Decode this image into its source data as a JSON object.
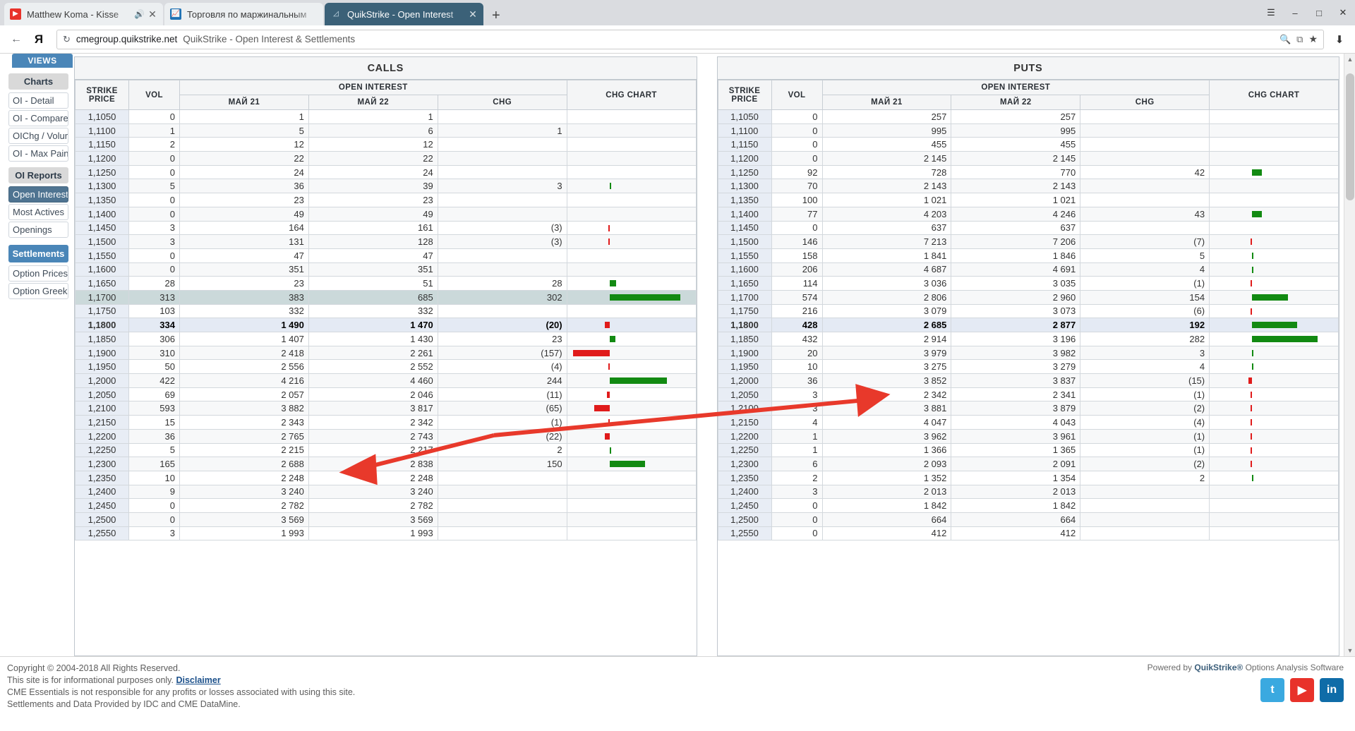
{
  "browser": {
    "tabs": [
      {
        "title": "Matthew Koma - Kisse",
        "icon": "youtube-icon",
        "muted": true,
        "active": false
      },
      {
        "title": "Торговля по маржинальным",
        "icon": "chart-icon",
        "muted": false,
        "active": false
      },
      {
        "title": "QuikStrike - Open Interest",
        "icon": "quikstrike-icon",
        "muted": false,
        "active": true
      }
    ],
    "new_tab_label": "+",
    "window_controls": {
      "menu": "☰",
      "minimize": "–",
      "maximize": "□",
      "close": "✕"
    },
    "toolbar": {
      "back": "←",
      "brand_logo": "Я",
      "reload": "↻",
      "url_host": "cmegroup.quikstrike.net",
      "url_title": "QuikStrike - Open Interest & Settlements",
      "zoom_icon": "🔍",
      "copy_icon": "⧉",
      "bookmark_icon": "★",
      "download_icon": "⬇"
    }
  },
  "sidebar": {
    "views_label": "VIEWS",
    "views_caret": "▾",
    "groups": [
      {
        "header": "Charts",
        "items": [
          {
            "label": "OI - Detail",
            "active": false
          },
          {
            "label": "OI - Compare",
            "active": false
          },
          {
            "label": "OIChg / Volume",
            "active": false
          },
          {
            "label": "OI - Max Pain",
            "active": false
          }
        ]
      },
      {
        "header": "OI Reports",
        "items": [
          {
            "label": "Open Interest",
            "active": true
          },
          {
            "label": "Most Actives",
            "active": false
          },
          {
            "label": "Openings",
            "active": false
          }
        ]
      }
    ],
    "settings_button": "Settlements",
    "settings_items": [
      {
        "label": "Option Prices",
        "active": false
      },
      {
        "label": "Option Greeks",
        "active": false
      }
    ]
  },
  "colors": {
    "accent_blue": "#4a86b8",
    "active_nav": "#4f7491",
    "positive": "#098209",
    "negative": "#cc1414",
    "bar_green": "#128a12",
    "bar_red": "#e01b1b",
    "highlight_teal": "#cbd9da",
    "highlight_blue": "#e4eaf4",
    "annotation_red": "#e8392b"
  },
  "chart_data": {
    "type": "table",
    "title": "QuikStrike - Open Interest & Settlements",
    "columns": [
      "STRIKE PRICE",
      "VOL",
      "МАЙ 21",
      "МАЙ 22",
      "CHG",
      "CHG CHART"
    ],
    "column_group": "OPEN INTEREST",
    "panels": [
      {
        "name": "CALLS",
        "rows": [
          {
            "strike": "1,1050",
            "vol": "0",
            "oi1": "1",
            "oi2": "1",
            "chg": "",
            "bar": 0
          },
          {
            "strike": "1,1100",
            "vol": "1",
            "oi1": "5",
            "oi2": "6",
            "chg": "1",
            "bar": 0
          },
          {
            "strike": "1,1150",
            "vol": "2",
            "oi1": "12",
            "oi2": "12",
            "chg": "",
            "bar": 0
          },
          {
            "strike": "1,1200",
            "vol": "0",
            "oi1": "22",
            "oi2": "22",
            "chg": "",
            "bar": 0
          },
          {
            "strike": "1,1250",
            "vol": "0",
            "oi1": "24",
            "oi2": "24",
            "chg": "",
            "bar": 0
          },
          {
            "strike": "1,1300",
            "vol": "5",
            "oi1": "36",
            "oi2": "39",
            "chg": "3",
            "bar": 3
          },
          {
            "strike": "1,1350",
            "vol": "0",
            "oi1": "23",
            "oi2": "23",
            "chg": "",
            "bar": 0
          },
          {
            "strike": "1,1400",
            "vol": "0",
            "oi1": "49",
            "oi2": "49",
            "chg": "",
            "bar": 0
          },
          {
            "strike": "1,1450",
            "vol": "3",
            "oi1": "164",
            "oi2": "161",
            "chg": "(3)",
            "bar": -3
          },
          {
            "strike": "1,1500",
            "vol": "3",
            "oi1": "131",
            "oi2": "128",
            "chg": "(3)",
            "bar": -3
          },
          {
            "strike": "1,1550",
            "vol": "0",
            "oi1": "47",
            "oi2": "47",
            "chg": "",
            "bar": 0
          },
          {
            "strike": "1,1600",
            "vol": "0",
            "oi1": "351",
            "oi2": "351",
            "chg": "",
            "bar": 0
          },
          {
            "strike": "1,1650",
            "vol": "28",
            "oi1": "23",
            "oi2": "51",
            "chg": "28",
            "bar": 28
          },
          {
            "strike": "1,1700",
            "vol": "313",
            "oi1": "383",
            "oi2": "685",
            "chg": "302",
            "bar": 302,
            "highlight": "teal"
          },
          {
            "strike": "1,1750",
            "vol": "103",
            "oi1": "332",
            "oi2": "332",
            "chg": "",
            "bar": 0
          },
          {
            "strike": "1,1800",
            "vol": "334",
            "oi1": "1 490",
            "oi2": "1 470",
            "chg": "(20)",
            "bar": -20,
            "highlight": "blue"
          },
          {
            "strike": "1,1850",
            "vol": "306",
            "oi1": "1 407",
            "oi2": "1 430",
            "chg": "23",
            "bar": 23
          },
          {
            "strike": "1,1900",
            "vol": "310",
            "oi1": "2 418",
            "oi2": "2 261",
            "chg": "(157)",
            "bar": -157
          },
          {
            "strike": "1,1950",
            "vol": "50",
            "oi1": "2 556",
            "oi2": "2 552",
            "chg": "(4)",
            "bar": -4
          },
          {
            "strike": "1,2000",
            "vol": "422",
            "oi1": "4 216",
            "oi2": "4 460",
            "chg": "244",
            "bar": 244
          },
          {
            "strike": "1,2050",
            "vol": "69",
            "oi1": "2 057",
            "oi2": "2 046",
            "chg": "(11)",
            "bar": -11
          },
          {
            "strike": "1,2100",
            "vol": "593",
            "oi1": "3 882",
            "oi2": "3 817",
            "chg": "(65)",
            "bar": -65
          },
          {
            "strike": "1,2150",
            "vol": "15",
            "oi1": "2 343",
            "oi2": "2 342",
            "chg": "(1)",
            "bar": -1
          },
          {
            "strike": "1,2200",
            "vol": "36",
            "oi1": "2 765",
            "oi2": "2 743",
            "chg": "(22)",
            "bar": -22
          },
          {
            "strike": "1,2250",
            "vol": "5",
            "oi1": "2 215",
            "oi2": "2 217",
            "chg": "2",
            "bar": 2
          },
          {
            "strike": "1,2300",
            "vol": "165",
            "oi1": "2 688",
            "oi2": "2 838",
            "chg": "150",
            "bar": 150
          },
          {
            "strike": "1,2350",
            "vol": "10",
            "oi1": "2 248",
            "oi2": "2 248",
            "chg": "",
            "bar": 0
          },
          {
            "strike": "1,2400",
            "vol": "9",
            "oi1": "3 240",
            "oi2": "3 240",
            "chg": "",
            "bar": 0
          },
          {
            "strike": "1,2450",
            "vol": "0",
            "oi1": "2 782",
            "oi2": "2 782",
            "chg": "",
            "bar": 0
          },
          {
            "strike": "1,2500",
            "vol": "0",
            "oi1": "3 569",
            "oi2": "3 569",
            "chg": "",
            "bar": 0
          },
          {
            "strike": "1,2550",
            "vol": "3",
            "oi1": "1 993",
            "oi2": "1 993",
            "chg": "",
            "bar": 0
          }
        ]
      },
      {
        "name": "PUTS",
        "rows": [
          {
            "strike": "1,1050",
            "vol": "0",
            "oi1": "257",
            "oi2": "257",
            "chg": "",
            "bar": 0
          },
          {
            "strike": "1,1100",
            "vol": "0",
            "oi1": "995",
            "oi2": "995",
            "chg": "",
            "bar": 0
          },
          {
            "strike": "1,1150",
            "vol": "0",
            "oi1": "455",
            "oi2": "455",
            "chg": "",
            "bar": 0
          },
          {
            "strike": "1,1200",
            "vol": "0",
            "oi1": "2 145",
            "oi2": "2 145",
            "chg": "",
            "bar": 0
          },
          {
            "strike": "1,1250",
            "vol": "92",
            "oi1": "728",
            "oi2": "770",
            "chg": "42",
            "bar": 42
          },
          {
            "strike": "1,1300",
            "vol": "70",
            "oi1": "2 143",
            "oi2": "2 143",
            "chg": "",
            "bar": 0
          },
          {
            "strike": "1,1350",
            "vol": "100",
            "oi1": "1 021",
            "oi2": "1 021",
            "chg": "",
            "bar": 0
          },
          {
            "strike": "1,1400",
            "vol": "77",
            "oi1": "4 203",
            "oi2": "4 246",
            "chg": "43",
            "bar": 43
          },
          {
            "strike": "1,1450",
            "vol": "0",
            "oi1": "637",
            "oi2": "637",
            "chg": "",
            "bar": 0
          },
          {
            "strike": "1,1500",
            "vol": "146",
            "oi1": "7 213",
            "oi2": "7 206",
            "chg": "(7)",
            "bar": -7
          },
          {
            "strike": "1,1550",
            "vol": "158",
            "oi1": "1 841",
            "oi2": "1 846",
            "chg": "5",
            "bar": 5
          },
          {
            "strike": "1,1600",
            "vol": "206",
            "oi1": "4 687",
            "oi2": "4 691",
            "chg": "4",
            "bar": 4
          },
          {
            "strike": "1,1650",
            "vol": "114",
            "oi1": "3 036",
            "oi2": "3 035",
            "chg": "(1)",
            "bar": -1
          },
          {
            "strike": "1,1700",
            "vol": "574",
            "oi1": "2 806",
            "oi2": "2 960",
            "chg": "154",
            "bar": 154
          },
          {
            "strike": "1,1750",
            "vol": "216",
            "oi1": "3 079",
            "oi2": "3 073",
            "chg": "(6)",
            "bar": -6
          },
          {
            "strike": "1,1800",
            "vol": "428",
            "oi1": "2 685",
            "oi2": "2 877",
            "chg": "192",
            "bar": 192,
            "highlight": "blue"
          },
          {
            "strike": "1,1850",
            "vol": "432",
            "oi1": "2 914",
            "oi2": "3 196",
            "chg": "282",
            "bar": 282
          },
          {
            "strike": "1,1900",
            "vol": "20",
            "oi1": "3 979",
            "oi2": "3 982",
            "chg": "3",
            "bar": 3
          },
          {
            "strike": "1,1950",
            "vol": "10",
            "oi1": "3 275",
            "oi2": "3 279",
            "chg": "4",
            "bar": 4
          },
          {
            "strike": "1,2000",
            "vol": "36",
            "oi1": "3 852",
            "oi2": "3 837",
            "chg": "(15)",
            "bar": -15
          },
          {
            "strike": "1,2050",
            "vol": "3",
            "oi1": "2 342",
            "oi2": "2 341",
            "chg": "(1)",
            "bar": -1
          },
          {
            "strike": "1,2100",
            "vol": "3",
            "oi1": "3 881",
            "oi2": "3 879",
            "chg": "(2)",
            "bar": -2
          },
          {
            "strike": "1,2150",
            "vol": "4",
            "oi1": "4 047",
            "oi2": "4 043",
            "chg": "(4)",
            "bar": -4
          },
          {
            "strike": "1,2200",
            "vol": "1",
            "oi1": "3 962",
            "oi2": "3 961",
            "chg": "(1)",
            "bar": -1
          },
          {
            "strike": "1,2250",
            "vol": "1",
            "oi1": "1 366",
            "oi2": "1 365",
            "chg": "(1)",
            "bar": -1
          },
          {
            "strike": "1,2300",
            "vol": "6",
            "oi1": "2 093",
            "oi2": "2 091",
            "chg": "(2)",
            "bar": -2
          },
          {
            "strike": "1,2350",
            "vol": "2",
            "oi1": "1 352",
            "oi2": "1 354",
            "chg": "2",
            "bar": 2
          },
          {
            "strike": "1,2400",
            "vol": "3",
            "oi1": "2 013",
            "oi2": "2 013",
            "chg": "",
            "bar": 0
          },
          {
            "strike": "1,2450",
            "vol": "0",
            "oi1": "1 842",
            "oi2": "1 842",
            "chg": "",
            "bar": 0
          },
          {
            "strike": "1,2500",
            "vol": "0",
            "oi1": "664",
            "oi2": "664",
            "chg": "",
            "bar": 0
          },
          {
            "strike": "1,2550",
            "vol": "0",
            "oi1": "412",
            "oi2": "412",
            "chg": "",
            "bar": 0
          }
        ]
      }
    ]
  },
  "footer": {
    "lines": [
      "Copyright © 2004-2018 All Rights Reserved.",
      "This site is for informational purposes only.",
      "CME Essentials is not responsible for any profits or losses associated with using this site.",
      "Settlements and Data Provided by IDC and CME DataMine."
    ],
    "disclaimer_link": "Disclaimer",
    "powered_prefix": "Powered by",
    "powered_brand": "QuikStrike®",
    "powered_suffix": "Options Analysis Software",
    "social": [
      {
        "name": "twitter-icon",
        "glyph": "t"
      },
      {
        "name": "youtube-icon",
        "glyph": "▶"
      },
      {
        "name": "linkedin-icon",
        "glyph": "in"
      }
    ]
  }
}
